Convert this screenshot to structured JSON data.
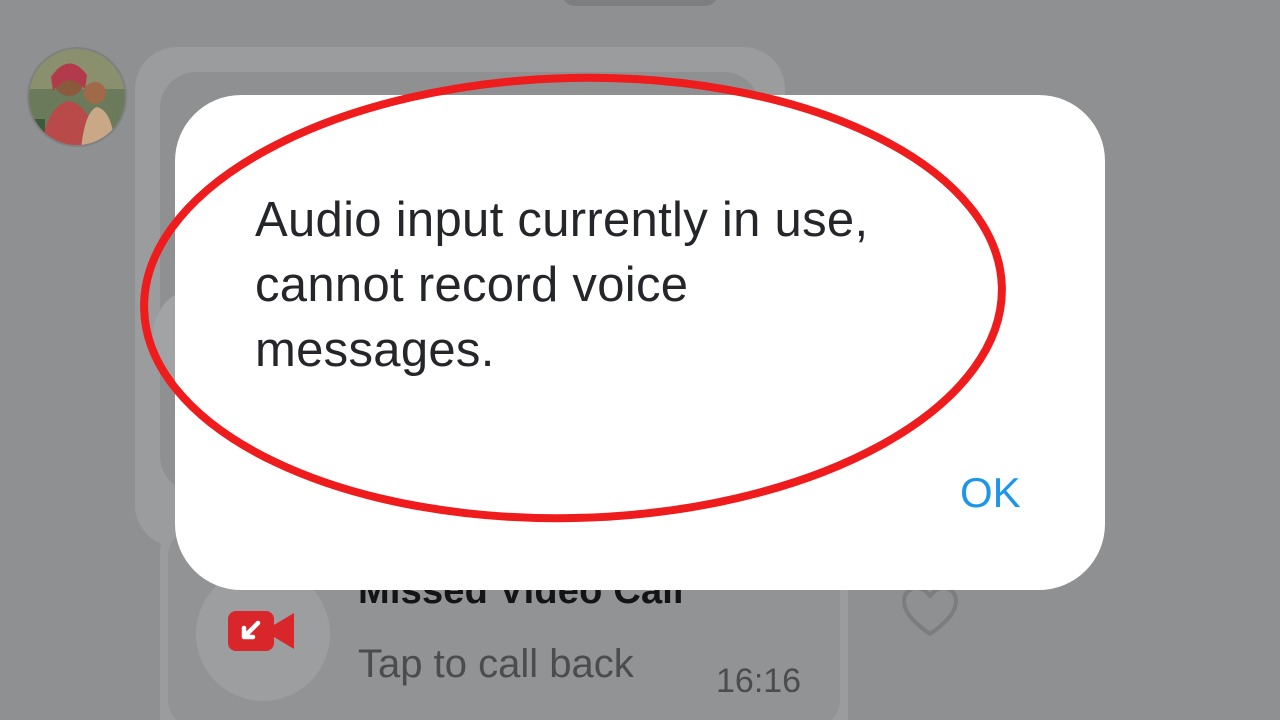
{
  "dialog": {
    "message": "Audio input currently in use, cannot record voice messages.",
    "ok_label": "OK"
  },
  "background_chat": {
    "call_title": "Missed Video Call",
    "call_subtitle": "Tap to call back",
    "call_time": "16:16"
  },
  "icons": {
    "avatar": "contact-avatar-photo",
    "call": "missed-video-call-icon",
    "reaction": "heart-icon"
  },
  "colors": {
    "overlay": "#8f9092",
    "dialog_bg": "#ffffff",
    "ok_accent": "#1e96e8",
    "missed_call_red": "#d9262a",
    "annotation_red": "#ee1c1c"
  }
}
